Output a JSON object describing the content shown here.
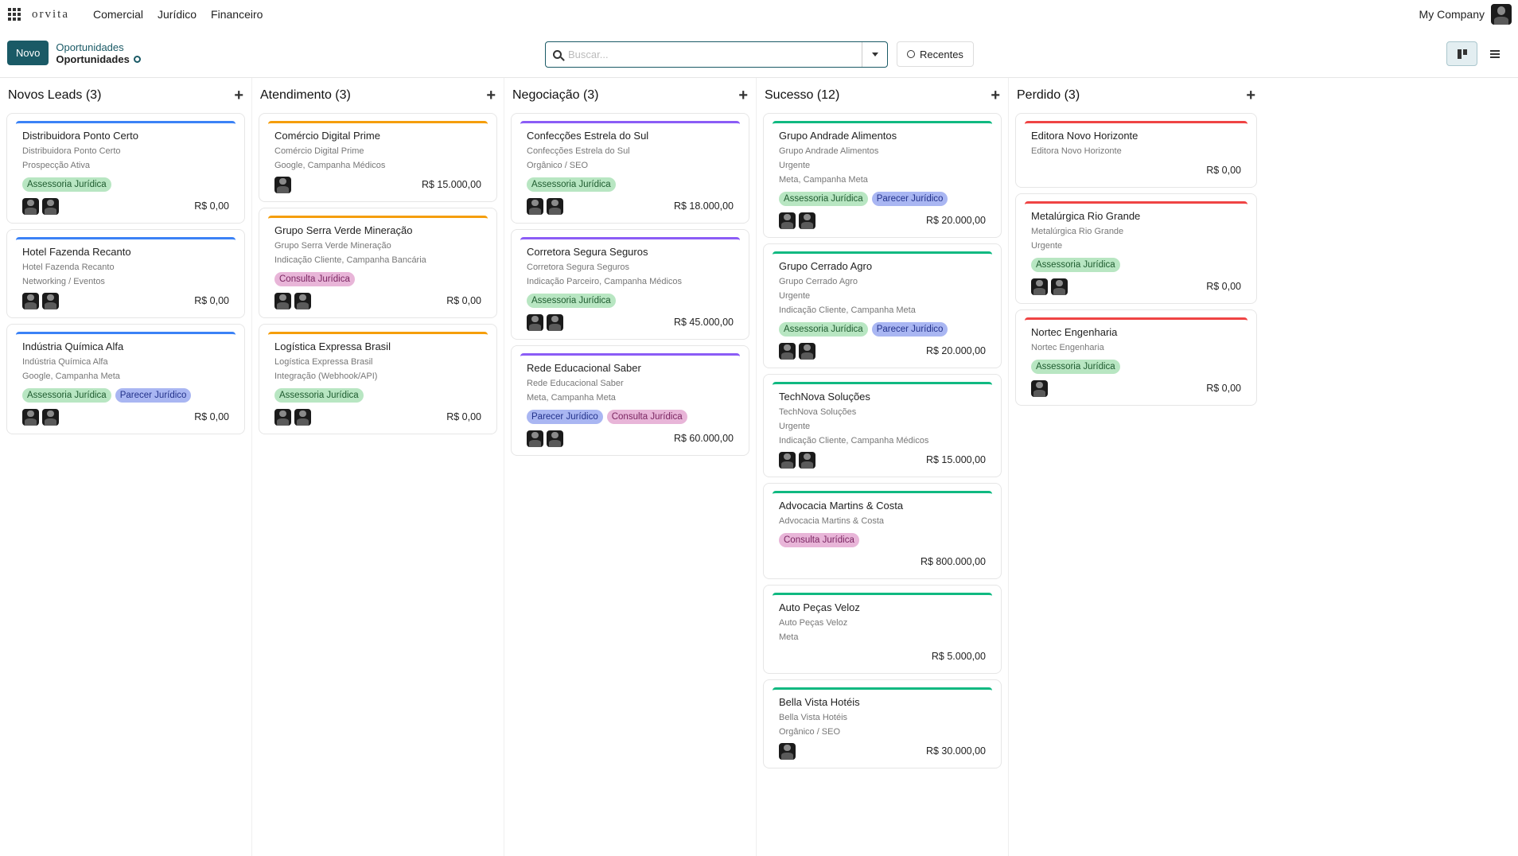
{
  "header": {
    "brand": "orvita",
    "menu": [
      "Comercial",
      "Jurídico",
      "Financeiro"
    ],
    "company": "My Company"
  },
  "control": {
    "new_label": "Novo",
    "breadcrumb_parent": "Oportunidades",
    "breadcrumb_current": "Oportunidades",
    "search_placeholder": "Buscar...",
    "recent_label": "Recentes"
  },
  "columns": [
    {
      "title": "Novos Leads (3)",
      "cards": [
        {
          "color": "blue",
          "title": "Distribuidora Ponto Certo",
          "lines": [
            "Distribuidora Ponto Certo",
            "Prospecção Ativa"
          ],
          "tags": [
            "Assessoria Jurídica"
          ],
          "avatars": 2,
          "amount": "R$ 0,00"
        },
        {
          "color": "blue",
          "title": "Hotel Fazenda Recanto",
          "lines": [
            "Hotel Fazenda Recanto",
            "Networking / Eventos"
          ],
          "tags": [],
          "avatars": 2,
          "amount": "R$ 0,00"
        },
        {
          "color": "blue",
          "title": "Indústria Química Alfa",
          "lines": [
            "Indústria Química Alfa",
            "Google, Campanha Meta"
          ],
          "tags": [
            "Assessoria Jurídica",
            "Parecer Jurídico"
          ],
          "avatars": 2,
          "amount": "R$ 0,00"
        }
      ]
    },
    {
      "title": "Atendimento (3)",
      "cards": [
        {
          "color": "orange",
          "title": "Comércio Digital Prime",
          "lines": [
            "Comércio Digital Prime",
            "Google, Campanha Médicos"
          ],
          "tags": [],
          "avatars": 1,
          "amount": "R$ 15.000,00"
        },
        {
          "color": "orange",
          "title": "Grupo Serra Verde Mineração",
          "lines": [
            "Grupo Serra Verde Mineração",
            "Indicação Cliente, Campanha Bancária"
          ],
          "tags": [
            "Consulta Jurídica"
          ],
          "avatars": 2,
          "amount": "R$ 0,00"
        },
        {
          "color": "orange",
          "title": "Logística Expressa Brasil",
          "lines": [
            "Logística Expressa Brasil",
            "Integração (Webhook/API)"
          ],
          "tags": [
            "Assessoria Jurídica"
          ],
          "avatars": 2,
          "amount": "R$ 0,00"
        }
      ]
    },
    {
      "title": "Negociação (3)",
      "cards": [
        {
          "color": "purple",
          "title": "Confecções Estrela do Sul",
          "lines": [
            "Confecções Estrela do Sul",
            "Orgânico / SEO"
          ],
          "tags": [
            "Assessoria Jurídica"
          ],
          "avatars": 2,
          "amount": "R$ 18.000,00"
        },
        {
          "color": "purple",
          "title": "Corretora Segura Seguros",
          "lines": [
            "Corretora Segura Seguros",
            "Indicação Parceiro, Campanha Médicos"
          ],
          "tags": [
            "Assessoria Jurídica"
          ],
          "avatars": 2,
          "amount": "R$ 45.000,00"
        },
        {
          "color": "purple",
          "title": "Rede Educacional Saber",
          "lines": [
            "Rede Educacional Saber",
            "Meta, Campanha Meta"
          ],
          "tags": [
            "Parecer Jurídico",
            "Consulta Jurídica"
          ],
          "avatars": 2,
          "amount": "R$ 60.000,00"
        }
      ]
    },
    {
      "title": "Sucesso (12)",
      "cards": [
        {
          "color": "green",
          "title": "Grupo Andrade Alimentos",
          "lines": [
            "Grupo Andrade Alimentos",
            "Urgente",
            "Meta, Campanha Meta"
          ],
          "tags": [
            "Assessoria Jurídica",
            "Parecer Jurídico"
          ],
          "avatars": 2,
          "amount": "R$ 20.000,00"
        },
        {
          "color": "green",
          "title": "Grupo Cerrado Agro",
          "lines": [
            "Grupo Cerrado Agro",
            "Urgente",
            "Indicação Cliente, Campanha Meta"
          ],
          "tags": [
            "Assessoria Jurídica",
            "Parecer Jurídico"
          ],
          "avatars": 2,
          "amount": "R$ 20.000,00"
        },
        {
          "color": "green",
          "title": "TechNova Soluções",
          "lines": [
            "TechNova Soluções",
            "Urgente",
            "Indicação Cliente, Campanha Médicos"
          ],
          "tags": [],
          "avatars": 2,
          "amount": "R$ 15.000,00"
        },
        {
          "color": "green",
          "title": "Advocacia Martins & Costa",
          "lines": [
            "Advocacia Martins & Costa"
          ],
          "tags": [
            "Consulta Jurídica"
          ],
          "avatars": 0,
          "amount": "R$ 800.000,00"
        },
        {
          "color": "green",
          "title": "Auto Peças Veloz",
          "lines": [
            "Auto Peças Veloz",
            "Meta"
          ],
          "tags": [],
          "avatars": 0,
          "amount": "R$ 5.000,00"
        },
        {
          "color": "green",
          "title": "Bella Vista Hotéis",
          "lines": [
            "Bella Vista Hotéis",
            "Orgânico / SEO"
          ],
          "tags": [],
          "avatars": 1,
          "amount": "R$ 30.000,00"
        }
      ]
    },
    {
      "title": "Perdido (3)",
      "cards": [
        {
          "color": "red",
          "title": "Editora Novo Horizonte",
          "lines": [
            "Editora Novo Horizonte"
          ],
          "tags": [],
          "avatars": 0,
          "amount": "R$ 0,00"
        },
        {
          "color": "red",
          "title": "Metalúrgica Rio Grande",
          "lines": [
            "Metalúrgica Rio Grande",
            "Urgente"
          ],
          "tags": [
            "Assessoria Jurídica"
          ],
          "avatars": 2,
          "amount": "R$ 0,00"
        },
        {
          "color": "red",
          "title": "Nortec Engenharia",
          "lines": [
            "Nortec Engenharia"
          ],
          "tags": [
            "Assessoria Jurídica"
          ],
          "avatars": 1,
          "amount": "R$ 0,00"
        }
      ]
    }
  ]
}
